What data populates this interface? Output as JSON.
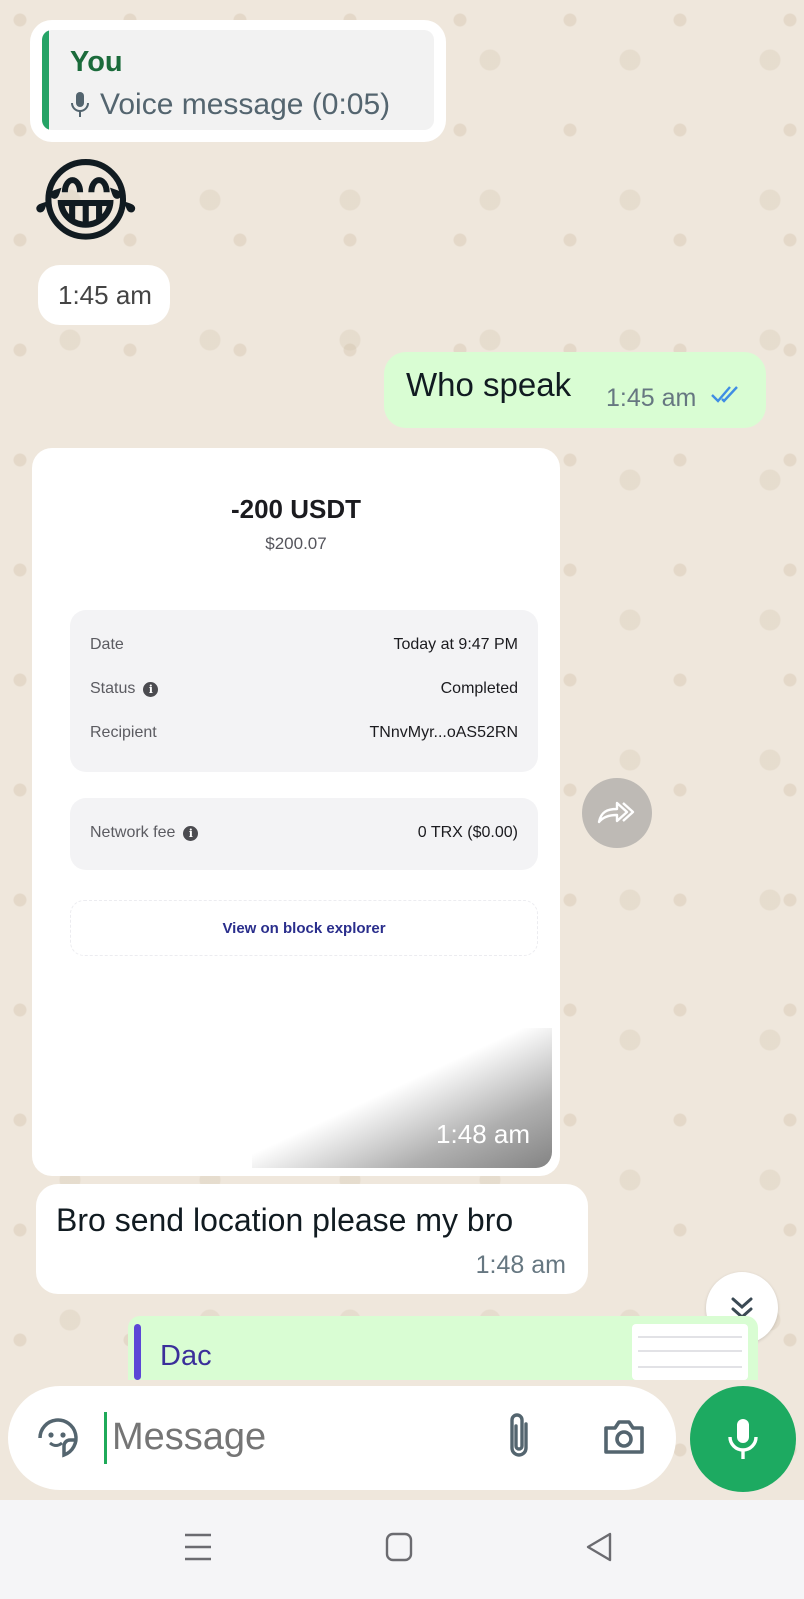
{
  "messages": {
    "quote": {
      "author": "You",
      "text": "Voice message (0:05)",
      "icon": "mic-icon"
    },
    "emoji": "😂",
    "emoji_time": "1:45 am",
    "outgoing": {
      "text": "Who speak",
      "time": "1:45 am",
      "status": "read"
    },
    "image_message": {
      "amount": "-200 USDT",
      "amount_usd": "$200.07",
      "rows": [
        {
          "label": "Date",
          "value": "Today at 9:47 PM"
        },
        {
          "label": "Status",
          "value": "Completed"
        },
        {
          "label": "Recipient",
          "value": "TNnvMyr...oAS52RN"
        }
      ],
      "fee": {
        "label": "Network fee",
        "value": "0 TRX ($0.00)"
      },
      "explorer_link": "View on block explorer",
      "time": "1:48 am"
    },
    "incoming": {
      "text": "Bro send location please my bro",
      "time": "1:48 am"
    }
  },
  "reply_preview": {
    "name": "Dac"
  },
  "composer": {
    "placeholder": "Message"
  },
  "colors": {
    "accent": "#1daa61",
    "outgoing_bubble": "#d9fdd3",
    "read_ticks": "#53bdeb"
  }
}
